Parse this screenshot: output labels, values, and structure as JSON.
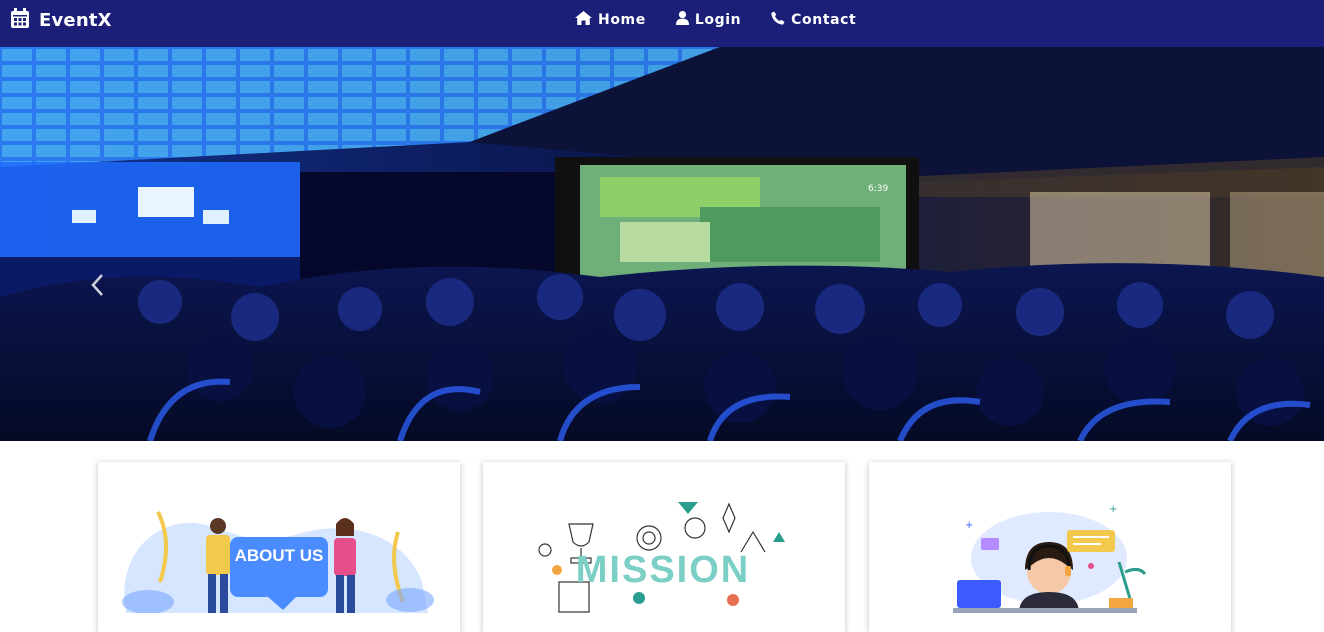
{
  "brand": {
    "name": "EventX",
    "icon": "calendar-icon"
  },
  "nav": [
    {
      "label": "Home",
      "icon": "home-icon"
    },
    {
      "label": "Login",
      "icon": "user-icon"
    },
    {
      "label": "Contact",
      "icon": "phone-icon"
    }
  ],
  "hero": {
    "screen_clock": "6:39"
  },
  "cards": [
    {
      "illustration": "about-us-illustration",
      "text": "ABOUT US"
    },
    {
      "illustration": "mission-illustration",
      "text": "MISSION"
    },
    {
      "illustration": "support-agent-illustration"
    }
  ],
  "colors": {
    "navbar": "#1b1f78",
    "accent_blue": "#2a5cff"
  }
}
